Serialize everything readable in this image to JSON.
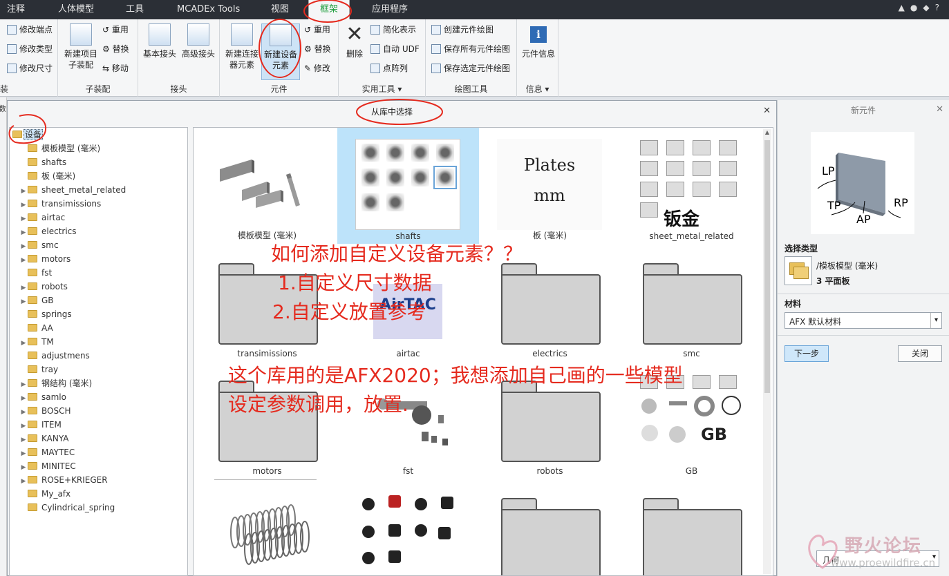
{
  "tabs": [
    "注释",
    "人体模型",
    "工具",
    "MCADEx Tools",
    "视图",
    "框架",
    "应用程序"
  ],
  "ribbon": {
    "group_partial": {
      "name": "装",
      "items": [
        "修改端点",
        "修改类型",
        "修改尺寸"
      ]
    },
    "subassembly": {
      "name": "子装配",
      "big": "新建项目子装配",
      "items": [
        "重用",
        "替换",
        "移动"
      ]
    },
    "joint": {
      "name": "接头",
      "buttons": [
        "基本接头",
        "高级接头"
      ]
    },
    "element": {
      "name": "元件",
      "buttons": [
        "新建连接器元素",
        "新建设备元素"
      ],
      "items": [
        "重用",
        "替换",
        "修改"
      ]
    },
    "utility": {
      "name": "实用工具",
      "delete": "删除",
      "items": [
        "简化表示",
        "自动 UDF",
        "点阵列"
      ]
    },
    "drawing": {
      "name": "绘图工具",
      "items": [
        "创建元件绘图",
        "保存所有元件绘图",
        "保存选定元件绘图"
      ]
    },
    "info": {
      "name": "信息",
      "button": "元件信息"
    }
  },
  "side_label": "数",
  "dialog": {
    "title": "从库中选择",
    "tree_root": "设备",
    "tree": [
      {
        "label": "模板模型 (毫米)",
        "expandable": false
      },
      {
        "label": "shafts",
        "expandable": false
      },
      {
        "label": "板 (毫米)",
        "expandable": false
      },
      {
        "label": "sheet_metal_related",
        "expandable": true
      },
      {
        "label": "transimissions",
        "expandable": true
      },
      {
        "label": "airtac",
        "expandable": true
      },
      {
        "label": "electrics",
        "expandable": true
      },
      {
        "label": "smc",
        "expandable": true
      },
      {
        "label": "motors",
        "expandable": true
      },
      {
        "label": "fst",
        "expandable": false
      },
      {
        "label": "robots",
        "expandable": true
      },
      {
        "label": "GB",
        "expandable": true
      },
      {
        "label": "springs",
        "expandable": false
      },
      {
        "label": "AA",
        "expandable": false
      },
      {
        "label": "TM",
        "expandable": true
      },
      {
        "label": "adjustmens",
        "expandable": false
      },
      {
        "label": "tray",
        "expandable": false
      },
      {
        "label": "钢结构 (毫米)",
        "expandable": true
      },
      {
        "label": "samlo",
        "expandable": true
      },
      {
        "label": "BOSCH",
        "expandable": true
      },
      {
        "label": "ITEM",
        "expandable": true
      },
      {
        "label": "KANYA",
        "expandable": true
      },
      {
        "label": "MAYTEC",
        "expandable": true
      },
      {
        "label": "MINITEC",
        "expandable": true
      },
      {
        "label": "ROSE+KRIEGER",
        "expandable": true
      },
      {
        "label": "My_afx",
        "expandable": false
      },
      {
        "label": "Cylindrical_spring",
        "expandable": false
      }
    ],
    "grid": [
      {
        "label": "模板模型 (毫米)",
        "kind": "plates3d"
      },
      {
        "label": "shafts",
        "kind": "thumbs",
        "selected": true
      },
      {
        "label": "板 (毫米)",
        "kind": "platesmm"
      },
      {
        "label": "sheet_metal_related",
        "kind": "sheetmetal"
      },
      {
        "label": "transimissions",
        "kind": "folder"
      },
      {
        "label": "airtac",
        "kind": "airtac"
      },
      {
        "label": "electrics",
        "kind": "folder"
      },
      {
        "label": "smc",
        "kind": "folder"
      },
      {
        "label": "motors",
        "kind": "folder"
      },
      {
        "label": "fst",
        "kind": "fst"
      },
      {
        "label": "robots",
        "kind": "folder"
      },
      {
        "label": "GB",
        "kind": "gb"
      },
      {
        "label": "",
        "kind": "springs"
      },
      {
        "label": "",
        "kind": "connectors"
      },
      {
        "label": "",
        "kind": "folder"
      },
      {
        "label": "",
        "kind": "folder"
      }
    ],
    "thumb_text": {
      "plates_line1": "Plates",
      "plates_line2": "mm",
      "sheetmetal_caption": "钣金",
      "airtac_logo": "AirTAC",
      "gb_caption": "GB"
    }
  },
  "right_panel": {
    "title": "新元件",
    "preview_labels": [
      "LP",
      "RP",
      "TP",
      "AP"
    ],
    "select_type_label": "选择类型",
    "type_path": "/模板模型 (毫米)",
    "type_name": "3 平面板",
    "material_label": "材料",
    "material_value": "AFX 默认材料",
    "next_button": "下一步",
    "close_button": "关闭",
    "geometry_dropdown": "几何"
  },
  "annotations": {
    "question": "如何添加自定义设备元素？？",
    "point1": "1.自定义尺寸数据",
    "point2": "2.自定义放置参考",
    "note_line1": "这个库用的是AFX2020；我想添加自己画的一些模型",
    "note_line2": "设定参数调用，放置."
  },
  "watermark": {
    "title": "野火论坛",
    "url": "www.proewildfire.cn"
  },
  "colors": {
    "tabbar_bg": "#2b2f36",
    "annotation_red": "#e52a1e",
    "selection_blue": "#bde3fa",
    "active_tab_text": "#1a9c3a"
  }
}
